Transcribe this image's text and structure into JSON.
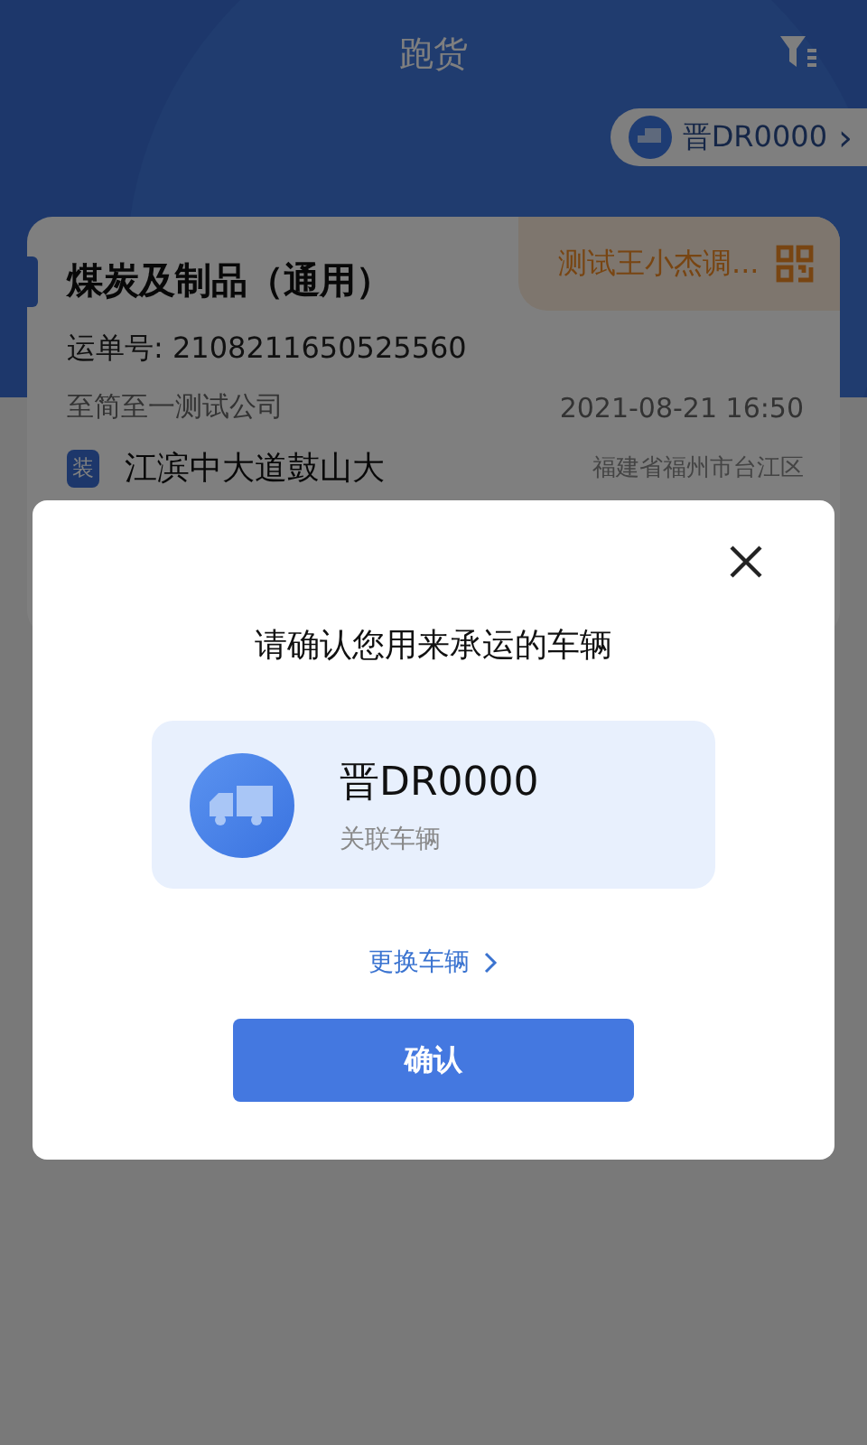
{
  "header": {
    "title": "跑货"
  },
  "vehicle_pill": {
    "plate": "晋DR0000",
    "chevron": "›"
  },
  "order": {
    "cargo": "煤炭及制品（通用）",
    "tag": "测试王小杰调...",
    "waybill": "运单号: 2108211650525560",
    "company": "至简至一测试公司",
    "time": "2021-08-21 16:50",
    "route": {
      "badge": "装",
      "place": "江滨中大道鼓山大",
      "region": "福建省福州市台江区"
    }
  },
  "dialog": {
    "title": "请确认您用来承运的车辆",
    "vehicle": {
      "plate": "晋DR0000",
      "note": "关联车辆"
    },
    "change_link": "更换车辆",
    "confirm": "确认"
  }
}
